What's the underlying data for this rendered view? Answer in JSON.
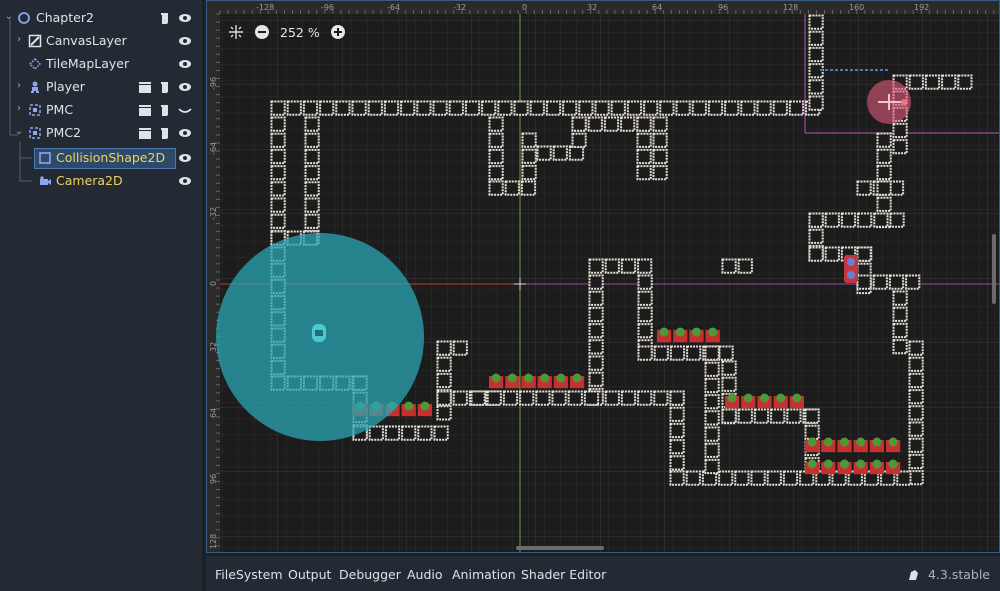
{
  "scene_tree": {
    "items": [
      {
        "label": "Chapter2",
        "icon": "node2d-icon",
        "arrow": "chevron-down-icon",
        "color": "#dfe3e8"
      },
      {
        "label": "CanvasLayer",
        "icon": "canvas-layer-icon",
        "arrow": "chevron-right-icon",
        "color": "#dfe3e8"
      },
      {
        "label": "TileMapLayer",
        "icon": "tilemap-icon",
        "arrow": "",
        "color": "#dfe3e8"
      },
      {
        "label": "Player",
        "icon": "character-icon",
        "arrow": "chevron-right-icon",
        "color": "#dfe3e8"
      },
      {
        "label": "PMC",
        "icon": "marker-icon",
        "arrow": "chevron-right-icon",
        "color": "#dfe3e8"
      },
      {
        "label": "PMC2",
        "icon": "marker-icon",
        "arrow": "chevron-down-icon",
        "color": "#dfe3e8"
      },
      {
        "label": "CollisionShape2D",
        "icon": "collision-shape-icon",
        "arrow": "",
        "color": "#f2d160"
      },
      {
        "label": "Camera2D",
        "icon": "camera-icon",
        "arrow": "",
        "color": "#f2d160"
      }
    ]
  },
  "viewport": {
    "zoom_label": "252 %",
    "ruler_top": [
      "-128",
      "-96",
      "-64",
      "-32",
      "0",
      "32",
      "64",
      "96",
      "128",
      "160",
      "192"
    ],
    "ruler_left": [
      "-96",
      "-64",
      "-32",
      "0",
      "32",
      "64",
      "96",
      "128"
    ]
  },
  "bottom_panel": {
    "tabs": [
      "FileSystem",
      "Output",
      "Debugger",
      "Audio",
      "Animation",
      "Shader Editor"
    ],
    "version": "4.3.stable"
  },
  "colors": {
    "accent": "#4d7ab0",
    "node_yellow": "#f2d160",
    "shape_cyan": "#2aa6b4",
    "x_axis": "#c4363f",
    "y_axis": "#7fc24a"
  }
}
